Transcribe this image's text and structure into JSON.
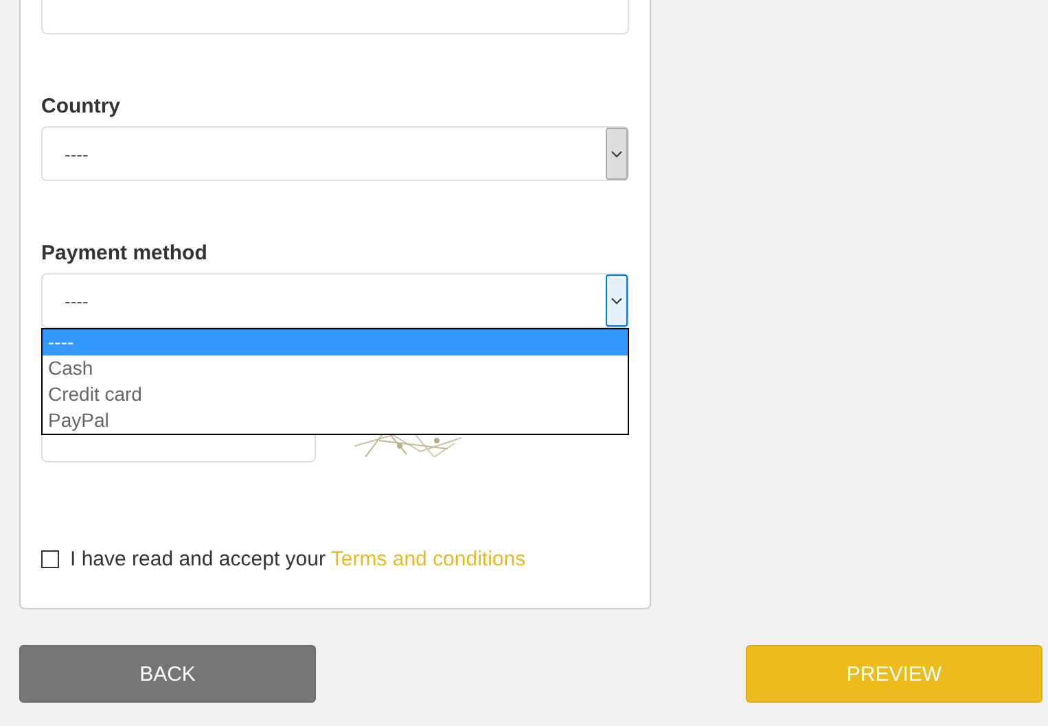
{
  "fields": [
    {
      "kind": "text"
    },
    {
      "kind": "select",
      "label": "Country",
      "value": "----",
      "expanded": false
    },
    {
      "kind": "select",
      "label": "Payment method",
      "value": "----",
      "expanded": true,
      "options": [
        {
          "label": "----",
          "selected": true
        },
        {
          "label": "Cash",
          "selected": false
        },
        {
          "label": "Credit card",
          "selected": false
        },
        {
          "label": "PayPal",
          "selected": false
        }
      ]
    }
  ],
  "consent": {
    "checked": false,
    "text": "I have read and accept your ",
    "link": "Terms and conditions"
  },
  "buttons": [
    {
      "label": "BACK",
      "kind": "secondary"
    },
    {
      "label": "PREVIEW",
      "kind": "primary"
    }
  ]
}
